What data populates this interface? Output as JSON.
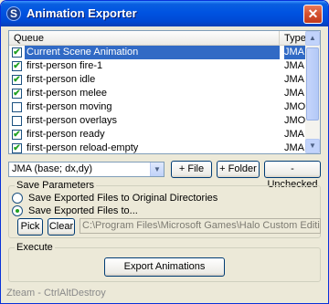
{
  "window": {
    "title": "Animation Exporter",
    "app_icon_glyph": "S",
    "close_glyph": "✕"
  },
  "queue": {
    "header": {
      "queue": "Queue",
      "type": "Type"
    },
    "items": [
      {
        "label": "Current Scene Animation",
        "type": "JMA",
        "checked": true,
        "selected": true
      },
      {
        "label": "first-person fire-1",
        "type": "JMA",
        "checked": true,
        "selected": false
      },
      {
        "label": "first-person idle",
        "type": "JMA",
        "checked": true,
        "selected": false
      },
      {
        "label": "first-person melee",
        "type": "JMA",
        "checked": true,
        "selected": false
      },
      {
        "label": "first-person moving",
        "type": "JMO",
        "checked": false,
        "selected": false
      },
      {
        "label": "first-person overlays",
        "type": "JMO",
        "checked": false,
        "selected": false
      },
      {
        "label": "first-person ready",
        "type": "JMA",
        "checked": true,
        "selected": false
      },
      {
        "label": "first-person reload-empty",
        "type": "JMA",
        "checked": true,
        "selected": false
      }
    ],
    "scroll_up_glyph": "▲",
    "scroll_down_glyph": "▼"
  },
  "toolbar": {
    "type_combo_value": "JMA (base; dx,dy)",
    "combo_arrow_glyph": "▼",
    "add_file_label": "+ File",
    "add_folder_label": "+ Folder",
    "unchecked_label": "- Unchecked"
  },
  "save": {
    "group_label": "Save Parameters",
    "option_original": "Save Exported Files to Original Directories",
    "option_to": "Save Exported Files to...",
    "selected_option": "to",
    "pick_label": "Pick",
    "clear_label": "Clear",
    "path_value": "C:\\Program Files\\Microsoft Games\\Halo Custom Edition\\data"
  },
  "execute": {
    "group_label": "Execute",
    "export_label": "Export Animations"
  },
  "status": {
    "text": "Zteam - CtrlAltDestroy"
  },
  "colors": {
    "selection": "#316ac5",
    "titlebar": "#0053e1",
    "check": "#21a121"
  }
}
